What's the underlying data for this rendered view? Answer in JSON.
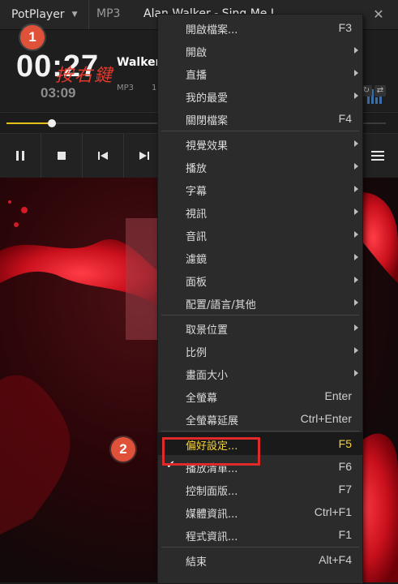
{
  "titlebar": {
    "app_name": "PotPlayer",
    "format_tab": "MP3",
    "title": "Alan Walker - Sing Me I",
    "pin_icon": "pin-icon",
    "close_icon": "close-icon"
  },
  "info": {
    "current_time": "00:27",
    "total_time": "03:09",
    "artist": "Walker",
    "format": "MP3",
    "channel": "1",
    "annotation_text": "按右鍵",
    "seek_progress": 0.12
  },
  "badges": {
    "step1": "1",
    "step2": "2"
  },
  "controls": {
    "icons": [
      "pause-icon",
      "stop-icon",
      "previous-icon",
      "next-icon",
      "menu-icon"
    ]
  },
  "menu": {
    "items": [
      {
        "label": "開啟檔案...",
        "shortcut": "F3",
        "submenu": false
      },
      {
        "label": "開啟",
        "shortcut": "",
        "submenu": true
      },
      {
        "label": "直播",
        "shortcut": "",
        "submenu": true
      },
      {
        "label": "我的最愛",
        "shortcut": "",
        "submenu": true
      },
      {
        "label": "關閉檔案",
        "shortcut": "F4",
        "submenu": false
      },
      {
        "label": "視覺效果",
        "shortcut": "",
        "submenu": true
      },
      {
        "label": "播放",
        "shortcut": "",
        "submenu": true
      },
      {
        "label": "字幕",
        "shortcut": "",
        "submenu": true
      },
      {
        "label": "視訊",
        "shortcut": "",
        "submenu": true
      },
      {
        "label": "音訊",
        "shortcut": "",
        "submenu": true
      },
      {
        "label": "濾鏡",
        "shortcut": "",
        "submenu": true
      },
      {
        "label": "面板",
        "shortcut": "",
        "submenu": true
      },
      {
        "label": "配置/語言/其他",
        "shortcut": "",
        "submenu": true
      },
      {
        "label": "取景位置",
        "shortcut": "",
        "submenu": true
      },
      {
        "label": "比例",
        "shortcut": "",
        "submenu": true
      },
      {
        "label": "畫面大小",
        "shortcut": "",
        "submenu": true
      },
      {
        "label": "全螢幕",
        "shortcut": "Enter",
        "submenu": false
      },
      {
        "label": "全螢幕延展",
        "shortcut": "Ctrl+Enter",
        "submenu": false
      },
      {
        "label": "偏好設定...",
        "shortcut": "F5",
        "submenu": false,
        "highlighted": true
      },
      {
        "label": "播放清單...",
        "shortcut": "F6",
        "submenu": false,
        "checked": true
      },
      {
        "label": "控制面版...",
        "shortcut": "F7",
        "submenu": false
      },
      {
        "label": "媒體資訊...",
        "shortcut": "Ctrl+F1",
        "submenu": false
      },
      {
        "label": "程式資訊...",
        "shortcut": "F1",
        "submenu": false
      },
      {
        "label": "結束",
        "shortcut": "Alt+F4",
        "submenu": false
      }
    ]
  },
  "colors": {
    "accent": "#e5c21a",
    "highlight_text": "#f6d33a",
    "badge": "#e0513a",
    "annotation_red": "#e02a2a"
  }
}
